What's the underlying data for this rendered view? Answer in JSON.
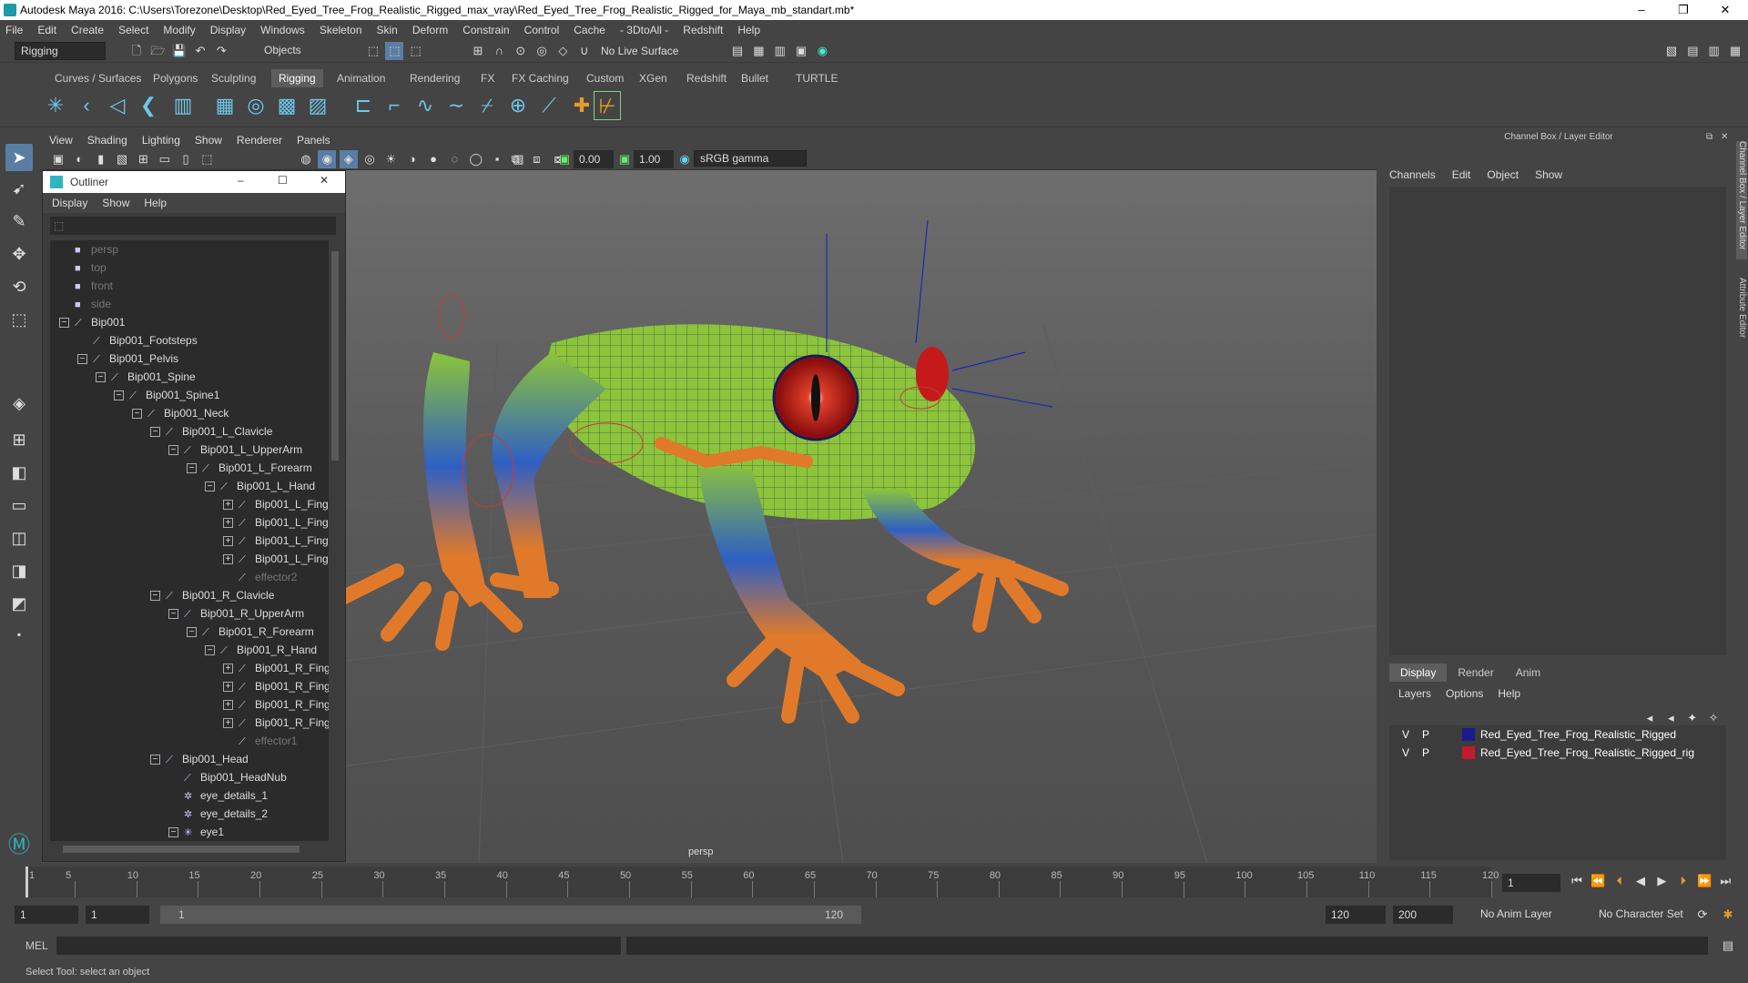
{
  "window": {
    "title": "Autodesk Maya 2016: C:\\Users\\Torezone\\Desktop\\Red_Eyed_Tree_Frog_Realistic_Rigged_max_vray\\Red_Eyed_Tree_Frog_Realistic_Rigged_for_Maya_mb_standart.mb*",
    "minimize": "–",
    "maximize": "❐",
    "close": "✕"
  },
  "menubar": [
    "File",
    "Edit",
    "Create",
    "Select",
    "Modify",
    "Display",
    "Windows",
    "Skeleton",
    "Skin",
    "Deform",
    "Constrain",
    "Control",
    "Cache",
    "- 3DtoAll -",
    "Redshift",
    "Help"
  ],
  "statusline": {
    "mode": "Rigging",
    "selection_mask": "Objects",
    "live_surface": "No Live Surface"
  },
  "shelf_tabs": [
    {
      "label": "Curves / Surfaces",
      "active": false
    },
    {
      "label": "Polygons",
      "active": false
    },
    {
      "label": "Sculpting",
      "active": false
    },
    {
      "label": "Rigging",
      "active": true
    },
    {
      "label": "Animation",
      "active": false
    },
    {
      "label": "Rendering",
      "active": false
    },
    {
      "label": "FX",
      "active": false
    },
    {
      "label": "FX Caching",
      "active": false
    },
    {
      "label": "Custom",
      "active": false
    },
    {
      "label": "XGen",
      "active": false
    },
    {
      "label": "Redshift",
      "active": false
    },
    {
      "label": "Bullet",
      "active": false
    },
    {
      "label": "TURTLE",
      "active": false
    }
  ],
  "viewport": {
    "menu": [
      "View",
      "Shading",
      "Lighting",
      "Show",
      "Renderer",
      "Panels"
    ],
    "near_value": "0.00",
    "far_value": "1.00",
    "color_space": "sRGB gamma",
    "camera_label": "persp"
  },
  "outliner": {
    "title": "Outliner",
    "menu": [
      "Display",
      "Show",
      "Help"
    ],
    "items": [
      {
        "label": "persp",
        "indent": 0,
        "expander": "",
        "icon": "camera-icon",
        "dim": true
      },
      {
        "label": "top",
        "indent": 0,
        "expander": "",
        "icon": "camera-icon",
        "dim": true
      },
      {
        "label": "front",
        "indent": 0,
        "expander": "",
        "icon": "camera-icon",
        "dim": true
      },
      {
        "label": "side",
        "indent": 0,
        "expander": "",
        "icon": "camera-icon",
        "dim": true
      },
      {
        "label": "Bip001",
        "indent": 0,
        "expander": "−",
        "icon": "joint-icon",
        "dim": false
      },
      {
        "label": "Bip001_Footsteps",
        "indent": 1,
        "expander": "",
        "icon": "joint-icon",
        "dim": false
      },
      {
        "label": "Bip001_Pelvis",
        "indent": 1,
        "expander": "−",
        "icon": "joint-icon",
        "dim": false
      },
      {
        "label": "Bip001_Spine",
        "indent": 2,
        "expander": "−",
        "icon": "joint-icon",
        "dim": false
      },
      {
        "label": "Bip001_Spine1",
        "indent": 3,
        "expander": "−",
        "icon": "joint-icon",
        "dim": false
      },
      {
        "label": "Bip001_Neck",
        "indent": 4,
        "expander": "−",
        "icon": "joint-icon",
        "dim": false
      },
      {
        "label": "Bip001_L_Clavicle",
        "indent": 5,
        "expander": "−",
        "icon": "joint-icon",
        "dim": false
      },
      {
        "label": "Bip001_L_UpperArm",
        "indent": 6,
        "expander": "−",
        "icon": "joint-icon",
        "dim": false
      },
      {
        "label": "Bip001_L_Forearm",
        "indent": 7,
        "expander": "−",
        "icon": "joint-icon",
        "dim": false
      },
      {
        "label": "Bip001_L_Hand",
        "indent": 8,
        "expander": "−",
        "icon": "joint-icon",
        "dim": false
      },
      {
        "label": "Bip001_L_Fing",
        "indent": 9,
        "expander": "+",
        "icon": "joint-icon",
        "dim": false
      },
      {
        "label": "Bip001_L_Fing",
        "indent": 9,
        "expander": "+",
        "icon": "joint-icon",
        "dim": false
      },
      {
        "label": "Bip001_L_Fing",
        "indent": 9,
        "expander": "+",
        "icon": "joint-icon",
        "dim": false
      },
      {
        "label": "Bip001_L_Fing",
        "indent": 9,
        "expander": "+",
        "icon": "joint-icon",
        "dim": false
      },
      {
        "label": "effector2",
        "indent": 9,
        "expander": "",
        "icon": "effector-icon",
        "dim": true
      },
      {
        "label": "Bip001_R_Clavicle",
        "indent": 5,
        "expander": "−",
        "icon": "joint-icon",
        "dim": false
      },
      {
        "label": "Bip001_R_UpperArm",
        "indent": 6,
        "expander": "−",
        "icon": "joint-icon",
        "dim": false
      },
      {
        "label": "Bip001_R_Forearm",
        "indent": 7,
        "expander": "−",
        "icon": "joint-icon",
        "dim": false
      },
      {
        "label": "Bip001_R_Hand",
        "indent": 8,
        "expander": "−",
        "icon": "joint-icon",
        "dim": false
      },
      {
        "label": "Bip001_R_Fing",
        "indent": 9,
        "expander": "+",
        "icon": "joint-icon",
        "dim": false
      },
      {
        "label": "Bip001_R_Fing",
        "indent": 9,
        "expander": "+",
        "icon": "joint-icon",
        "dim": false
      },
      {
        "label": "Bip001_R_Fing",
        "indent": 9,
        "expander": "+",
        "icon": "joint-icon",
        "dim": false
      },
      {
        "label": "Bip001_R_Fing",
        "indent": 9,
        "expander": "+",
        "icon": "joint-icon",
        "dim": false
      },
      {
        "label": "effector1",
        "indent": 9,
        "expander": "",
        "icon": "effector-icon",
        "dim": true
      },
      {
        "label": "Bip001_Head",
        "indent": 5,
        "expander": "−",
        "icon": "joint-icon",
        "dim": false
      },
      {
        "label": "Bip001_HeadNub",
        "indent": 6,
        "expander": "",
        "icon": "joint-icon",
        "dim": false
      },
      {
        "label": "eye_details_1",
        "indent": 6,
        "expander": "",
        "icon": "group-icon",
        "dim": false
      },
      {
        "label": "eye_details_2",
        "indent": 6,
        "expander": "",
        "icon": "group-icon",
        "dim": false
      },
      {
        "label": "eye1",
        "indent": 6,
        "expander": "−",
        "icon": "locator-icon",
        "dim": false
      }
    ]
  },
  "channel_box": {
    "header": "Channel Box / Layer Editor",
    "menu": [
      "Channels",
      "Edit",
      "Object",
      "Show"
    ],
    "layer_tabs": [
      {
        "label": "Display",
        "active": true
      },
      {
        "label": "Render",
        "active": false
      },
      {
        "label": "Anim",
        "active": false
      }
    ],
    "layer_menu": [
      "Layers",
      "Options",
      "Help"
    ],
    "layers": [
      {
        "v": "V",
        "p": "P",
        "color": "#1a1a8c",
        "name": "Red_Eyed_Tree_Frog_Realistic_Rigged"
      },
      {
        "v": "V",
        "p": "P",
        "color": "#c41a2e",
        "name": "Red_Eyed_Tree_Frog_Realistic_Rigged_rig"
      }
    ],
    "side_tabs": [
      "Channel Box / Layer Editor",
      "Attribute Editor"
    ]
  },
  "timeline": {
    "ticks": [
      "1",
      "5",
      "10",
      "15",
      "20",
      "25",
      "30",
      "35",
      "40",
      "45",
      "50",
      "55",
      "60",
      "65",
      "70",
      "75",
      "80",
      "85",
      "90",
      "95",
      "100",
      "105",
      "110",
      "115",
      "120"
    ],
    "current_frame": "1"
  },
  "range": {
    "start": "1",
    "playback_start": "1",
    "slider_start": "1",
    "slider_end": "120",
    "playback_end": "120",
    "end": "200",
    "anim_layer": "No Anim Layer",
    "character_set": "No Character Set"
  },
  "cmdline": {
    "label": "MEL"
  },
  "helpline": {
    "text": "Select Tool: select an object"
  },
  "colors": {
    "accent": "#5a7ea3",
    "frog_green": "#8cc43a",
    "frog_blue": "#2f5fc4",
    "frog_orange": "#e07a2a",
    "eye_red": "#c41a1a"
  }
}
